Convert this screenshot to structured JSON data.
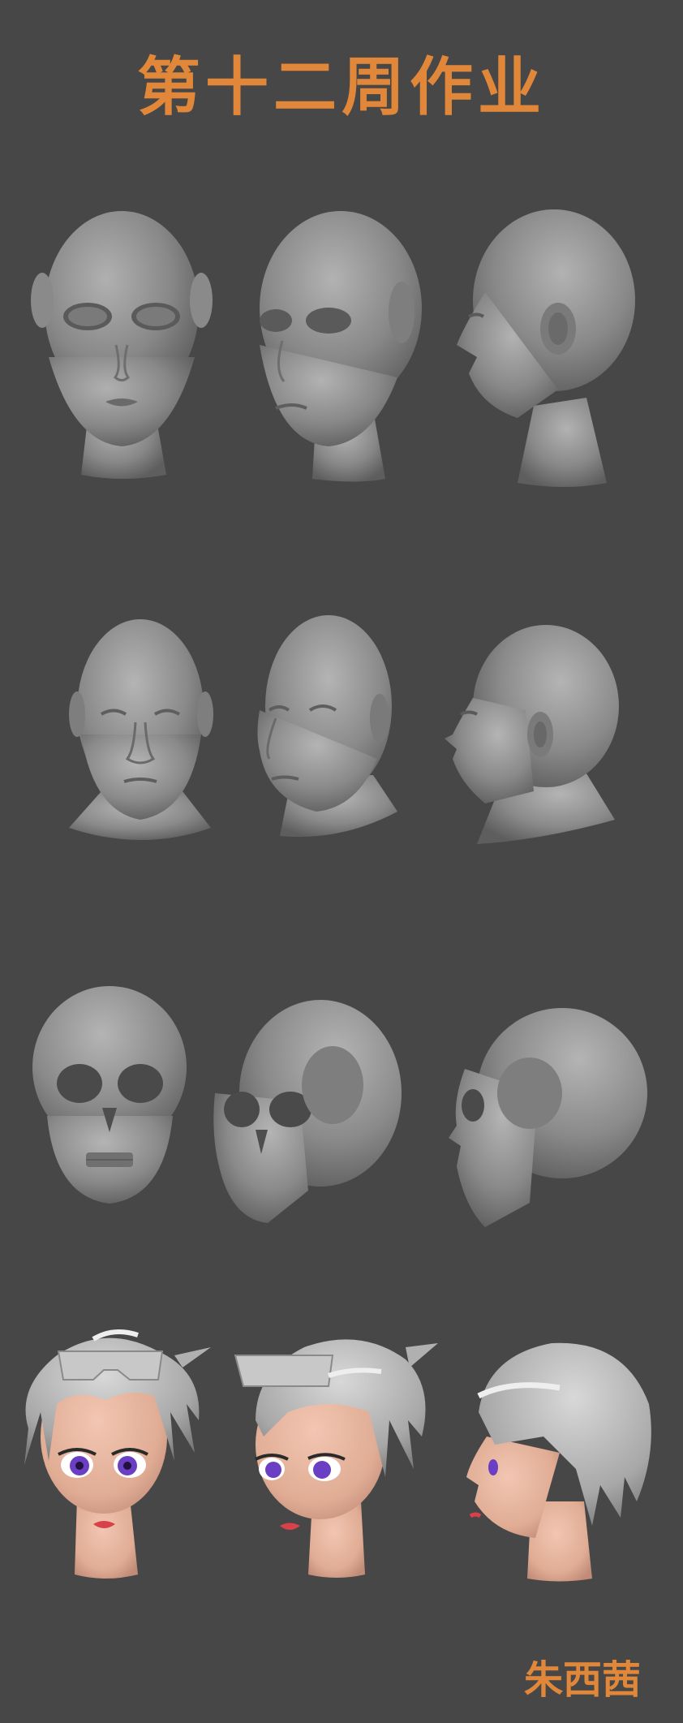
{
  "title": "第十二周作业",
  "author": "朱西茜",
  "colors": {
    "background": "#474747",
    "title_text": "#E0873A",
    "clay": "#8E8E8E",
    "skin": "#E7B49E",
    "hair": "#B9B9B9",
    "eye_iris": "#6B3FC4",
    "lips": "#D8414A"
  },
  "rows": [
    {
      "subject": "stylized-child-head",
      "views": [
        "front",
        "three-quarter",
        "side"
      ]
    },
    {
      "subject": "realistic-male-head",
      "views": [
        "front",
        "three-quarter",
        "side"
      ]
    },
    {
      "subject": "skull",
      "views": [
        "front",
        "three-quarter",
        "side"
      ]
    },
    {
      "subject": "stylized-girl-head-with-hair-and-goggles",
      "views": [
        "front",
        "three-quarter",
        "side"
      ]
    }
  ]
}
